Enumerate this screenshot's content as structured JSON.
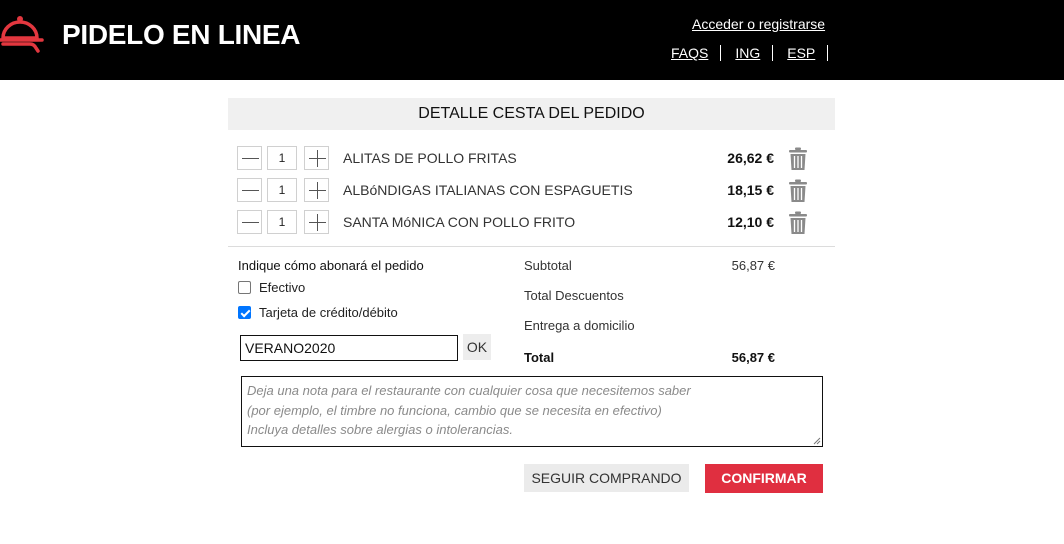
{
  "header": {
    "brand": "PIDELO EN LINEA",
    "logo_icon": "food-cloche-icon",
    "brand_color": "#e2373f",
    "login_link": "Acceder o registrarse",
    "nav": [
      "FAQS",
      "ING",
      "ESP"
    ]
  },
  "cart": {
    "title": "DETALLE CESTA DEL PEDIDO",
    "items": [
      {
        "qty": "1",
        "name": "ALITAS DE POLLO FRITAS",
        "price": "26,62 €"
      },
      {
        "qty": "1",
        "name": "ALBóNDIGAS ITALIANAS CON ESPAGUETIS",
        "price": "18,15 €"
      },
      {
        "qty": "1",
        "name": "SANTA MóNICA CON POLLO FRITO",
        "price": "12,10 €"
      }
    ]
  },
  "payment": {
    "title": "Indique cómo abonará el pedido",
    "options": [
      {
        "label": "Efectivo",
        "checked": false
      },
      {
        "label": "Tarjeta de crédito/débito",
        "checked": true
      }
    ],
    "coupon_value": "VERANO2020",
    "coupon_button": "OK"
  },
  "totals": {
    "subtotal_label": "Subtotal",
    "subtotal_value": "56,87 €",
    "discounts_label": "Total Descuentos",
    "delivery_label": "Entrega a domicilio",
    "total_label": "Total",
    "total_value": "56,87 €"
  },
  "notes": {
    "placeholder_lines": [
      "Deja una nota para el restaurante con cualquier cosa que necesitemos saber",
      "(por ejemplo, el timbre no funciona, cambio que se necesita en efectivo)",
      "Incluya detalles sobre alergias o intolerancias."
    ]
  },
  "actions": {
    "continue_label": "SEGUIR COMPRANDO",
    "confirm_label": "CONFIRMAR",
    "confirm_color": "#e02f40"
  }
}
